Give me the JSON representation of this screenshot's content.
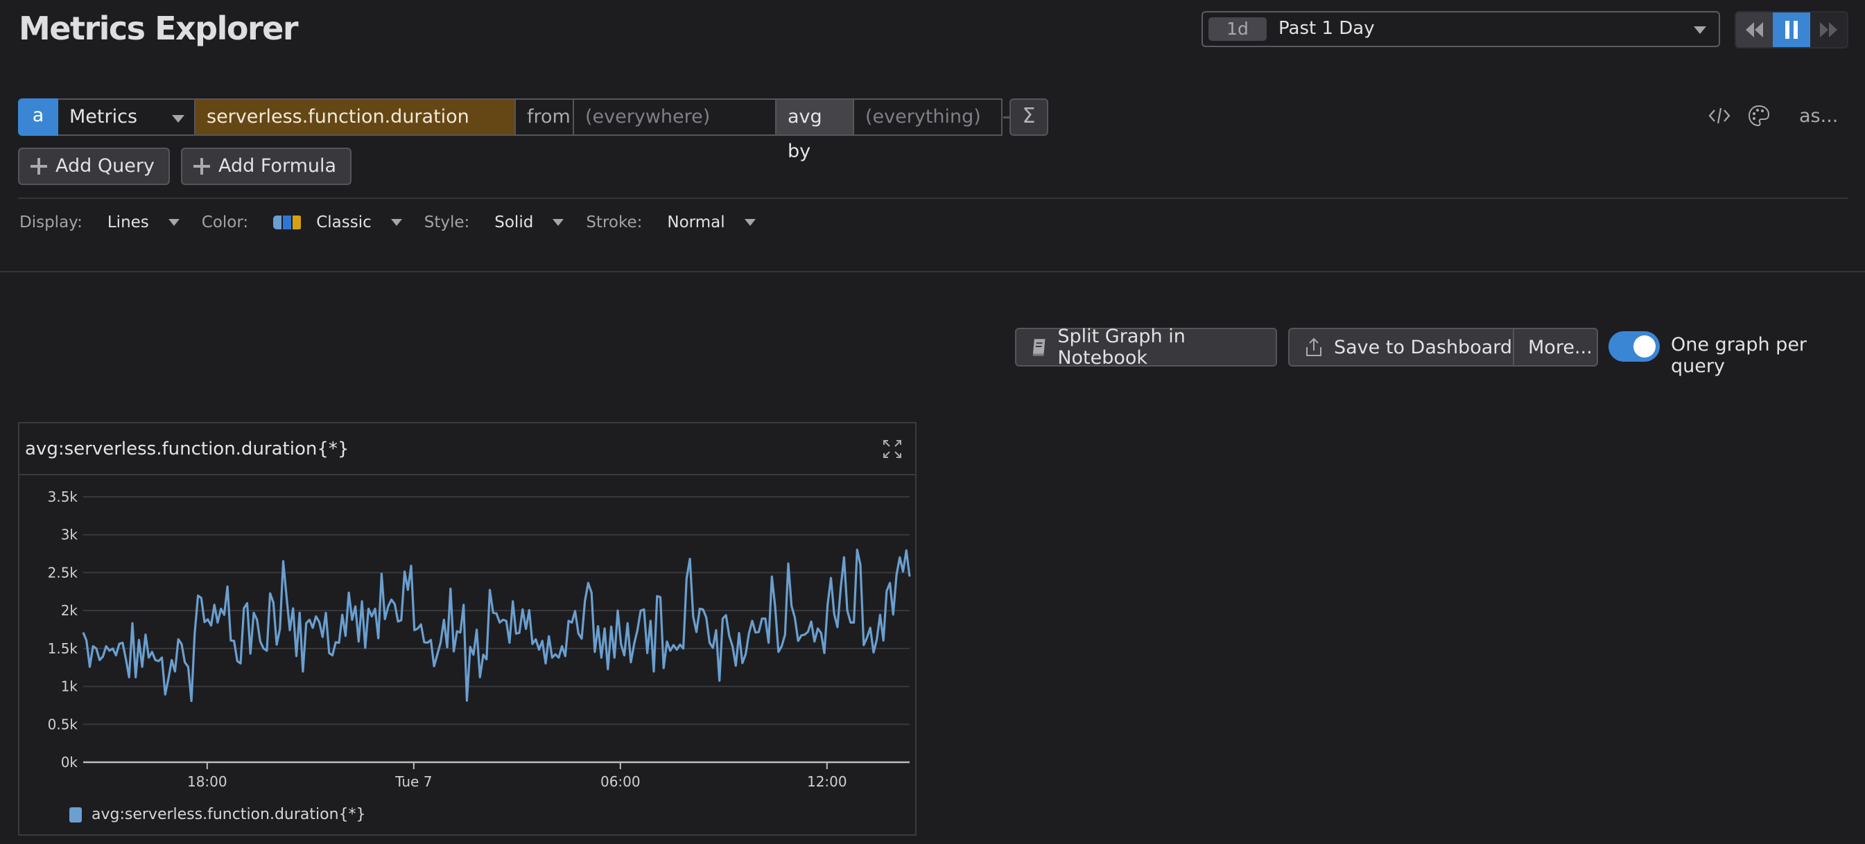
{
  "header": {
    "title": "Metrics Explorer",
    "time_badge": "1d",
    "time_label": "Past 1 Day",
    "playback": {
      "back": "rewind",
      "pause": "pause",
      "forward": "fast-forward",
      "active": "pause"
    }
  },
  "query": {
    "letter": "a",
    "source": "Metrics",
    "metric": "serverless.function.duration",
    "from_label": "from",
    "from_placeholder": "(everywhere)",
    "agg_label": "avg by",
    "agg_placeholder": "(everything)",
    "sigma": "Σ",
    "tools": {
      "code": "</>",
      "more": "as..."
    }
  },
  "buttons": {
    "add_query": "Add Query",
    "add_formula": "Add Formula"
  },
  "display_options": {
    "display_label": "Display:",
    "display_value": "Lines",
    "color_label": "Color:",
    "color_value": "Classic",
    "color_swatch": [
      "#6a9fcf",
      "#2f76d2",
      "#d4a20f"
    ],
    "style_label": "Style:",
    "style_value": "Solid",
    "stroke_label": "Stroke:",
    "stroke_value": "Normal"
  },
  "actions": {
    "split_graph": "Split Graph in Notebook",
    "save_dashboard": "Save to Dashboard",
    "more": "More...",
    "toggle_label": "One graph per query",
    "toggle_on": true
  },
  "widget": {
    "title": "avg:serverless.function.duration{*}",
    "legend": "avg:serverless.function.duration{*}"
  },
  "colors": {
    "accent": "#3a86d4",
    "series": "#6a9fcf",
    "metric_bg": "#654716"
  },
  "chart_data": {
    "type": "line",
    "title": "avg:serverless.function.duration{*}",
    "xlabel": "",
    "ylabel": "",
    "x_unit": "hours since start (Past 1 Day window)",
    "xlim": [
      0,
      24
    ],
    "ylim": [
      0,
      3500
    ],
    "yticks": [
      0,
      500,
      1000,
      1500,
      2000,
      2500,
      3000,
      3500
    ],
    "ytick_labels": [
      "0k",
      "0.5k",
      "1k",
      "1.5k",
      "2k",
      "2.5k",
      "3k",
      "3.5k"
    ],
    "xticks": [
      3.6,
      9.6,
      15.6,
      21.6
    ],
    "xtick_labels": [
      "18:00",
      "Tue 7",
      "06:00",
      "12:00"
    ],
    "grid": true,
    "legend_position": "bottom-left",
    "series": [
      {
        "name": "avg:serverless.function.duration{*}",
        "color": "#6a9fcf",
        "values": [
          1712,
          1606,
          1258,
          1530,
          1500,
          1348,
          1394,
          1530,
          1470,
          1500,
          1410,
          1560,
          1576,
          1364,
          1120,
          1833,
          1120,
          1612,
          1258,
          1682,
          1380,
          1455,
          1348,
          1333,
          1380,
          894,
          1106,
          1348,
          1197,
          1621,
          1560,
          1318,
          1258,
          809,
          1697,
          2197,
          2167,
          1848,
          1885,
          1803,
          2076,
          1842,
          2024,
          1945,
          2318,
          1606,
          1600,
          1333,
          1303,
          2030,
          2097,
          1434,
          1970,
          1879,
          1591,
          1500,
          1470,
          2227,
          2106,
          1551,
          1758,
          2652,
          2182,
          1742,
          2030,
          1400,
          1970,
          1197,
          1833,
          1879,
          1773,
          1924,
          1848,
          1652,
          1970,
          1440,
          1409,
          1582,
          1576,
          1945,
          1667,
          2236,
          1879,
          2055,
          1591,
          2121,
          1509,
          2024,
          1924,
          2024,
          1636,
          2485,
          1888,
          2055,
          2145,
          2085,
          1855,
          1873,
          2515,
          2273,
          2591,
          1742,
          1764,
          1818,
          1582,
          1576,
          1612,
          1267,
          1424,
          1582,
          1879,
          1515,
          2288,
          1461,
          1727,
          1712,
          2076,
          812,
          1521,
          1418,
          1748,
          1121,
          1418,
          1358,
          2273,
          1970,
          1964,
          1842,
          1879,
          1864,
          1576,
          2121,
          1697,
          1706,
          2015,
          1758,
          2006,
          1560,
          1621,
          1485,
          1600,
          1303,
          1661,
          1380,
          1424,
          1380,
          1530,
          1400,
          1864,
          1842,
          1994,
          1697,
          1630,
          2127,
          2364,
          2236,
          1455,
          1794,
          1380,
          1764,
          1227,
          1788,
          1380,
          2000,
          1560,
          1409,
          1833,
          1318,
          1560,
          1742,
          2000,
          2015,
          1440,
          1864,
          1197,
          2191,
          2176,
          1242,
          1591,
          1470,
          1545,
          1485,
          1551,
          1500,
          2424,
          2682,
          1924,
          1718,
          2024,
          2015,
          1909,
          1576,
          1509,
          1742,
          1076,
          1894,
          1939,
          1667,
          1530,
          1273,
          1703,
          1309,
          1424,
          1697,
          1864,
          1712,
          1718,
          1894,
          1894,
          1576,
          2448,
          2045,
          1455,
          1530,
          1682,
          2621,
          2061,
          1909,
          1600,
          1673,
          1682,
          1721,
          1855,
          1591,
          1764,
          1703,
          1440,
          2076,
          2430,
          1955,
          1782,
          2303,
          2703,
          2000,
          1842,
          1842,
          2803,
          2606,
          1545,
          1642,
          1773,
          1448,
          1621,
          1945,
          1606,
          2258,
          2364,
          1948,
          2470,
          2703,
          2515,
          2794,
          2448
        ]
      }
    ]
  }
}
